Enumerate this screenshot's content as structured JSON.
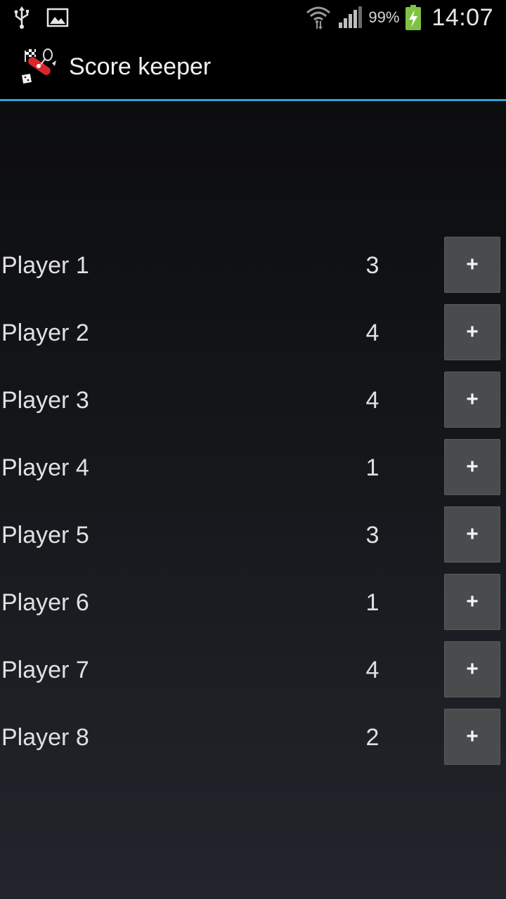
{
  "status_bar": {
    "icons_left": [
      "usb-icon",
      "image-notification-icon"
    ],
    "icons_right": [
      "wifi-icon",
      "signal-icon"
    ],
    "battery_percent": "99%",
    "time": "14:07"
  },
  "action_bar": {
    "title": "Score keeper",
    "accent_color": "#33a3d6"
  },
  "players": [
    {
      "name": "Player 1",
      "score": "3",
      "add_label": "+"
    },
    {
      "name": "Player 2",
      "score": "4",
      "add_label": "+"
    },
    {
      "name": "Player 3",
      "score": "4",
      "add_label": "+"
    },
    {
      "name": "Player 4",
      "score": "1",
      "add_label": "+"
    },
    {
      "name": "Player 5",
      "score": "3",
      "add_label": "+"
    },
    {
      "name": "Player 6",
      "score": "1",
      "add_label": "+"
    },
    {
      "name": "Player 7",
      "score": "4",
      "add_label": "+"
    },
    {
      "name": "Player 8",
      "score": "2",
      "add_label": "+"
    }
  ]
}
